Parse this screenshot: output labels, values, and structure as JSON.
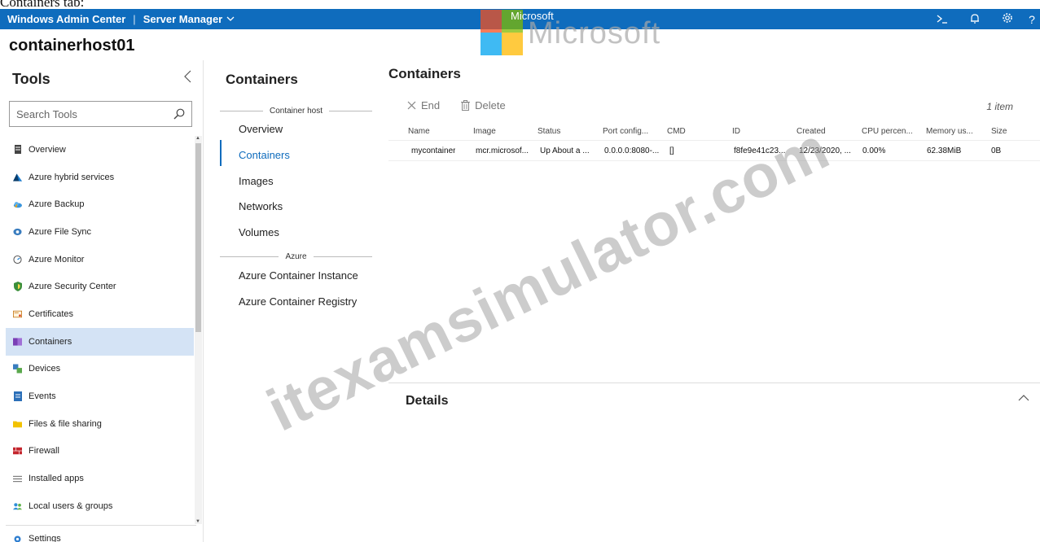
{
  "page_caption": "Containers tab:",
  "topbar": {
    "brand": "Windows Admin Center",
    "separator": "|",
    "server_manager": "Server Manager",
    "icons": [
      "terminal-icon",
      "bell-icon",
      "gear-icon",
      "help-icon"
    ]
  },
  "watermark": {
    "logo_small": "Microsoft",
    "logo_big": "Microsoft",
    "site": "itexamsimulator.com"
  },
  "host_name": "containerhost01",
  "tools": {
    "title": "Tools",
    "search_placeholder": "Search Tools",
    "items": [
      {
        "label": "Overview",
        "icon": "server-icon"
      },
      {
        "label": "Azure hybrid services",
        "icon": "azure-icon"
      },
      {
        "label": "Azure Backup",
        "icon": "cloud-backup-icon"
      },
      {
        "label": "Azure File Sync",
        "icon": "file-sync-icon"
      },
      {
        "label": "Azure Monitor",
        "icon": "monitor-gauge-icon"
      },
      {
        "label": "Azure Security Center",
        "icon": "shield-icon"
      },
      {
        "label": "Certificates",
        "icon": "certificate-icon"
      },
      {
        "label": "Containers",
        "icon": "container-cube-icon"
      },
      {
        "label": "Devices",
        "icon": "devices-icon"
      },
      {
        "label": "Events",
        "icon": "events-log-icon"
      },
      {
        "label": "Files & file sharing",
        "icon": "folder-icon"
      },
      {
        "label": "Firewall",
        "icon": "firewall-icon"
      },
      {
        "label": "Installed apps",
        "icon": "list-icon"
      },
      {
        "label": "Local users & groups",
        "icon": "users-icon"
      }
    ],
    "active_index": 7,
    "settings_label": "Settings"
  },
  "nav": {
    "title": "Containers",
    "group_host": "Container host",
    "host_items": [
      "Overview",
      "Containers",
      "Images",
      "Networks",
      "Volumes"
    ],
    "active_item": "Containers",
    "group_azure": "Azure",
    "azure_items": [
      "Azure Container Instance",
      "Azure Container Registry"
    ]
  },
  "content": {
    "title": "Containers",
    "toolbar": {
      "end_label": "End",
      "delete_label": "Delete"
    },
    "item_count": "1 item",
    "columns": [
      "Name",
      "Image",
      "Status",
      "Port config...",
      "CMD",
      "ID",
      "Created",
      "CPU percen...",
      "Memory us...",
      "Size"
    ],
    "rows": [
      [
        "mycontainer",
        "mcr.microsof...",
        "Up About a ...",
        "0.0.0.0:8080-...",
        "[]",
        "f8fe9e41c23...",
        "12/23/2020, ...",
        "0.00%",
        "62.38MiB",
        "0B"
      ]
    ],
    "details_title": "Details"
  }
}
